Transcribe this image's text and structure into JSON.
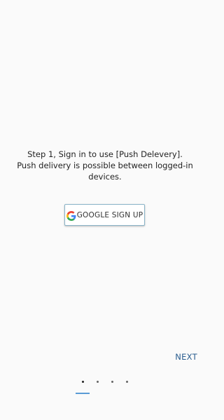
{
  "intro": {
    "step_text": "Step 1, Sign in to use [Push Delevery].\nPush delivery is possible between logged-in\ndevices."
  },
  "google_button": {
    "label": "GOOGLE SIGN UP",
    "icon": "google-g-icon"
  },
  "navigation": {
    "next_label": "NEXT"
  },
  "pager": {
    "page_count": 4,
    "current_page": 1
  },
  "colors": {
    "background": "#fafafa",
    "next_text": "#2a5d8f",
    "indicator": "#5b9bd5",
    "button_border": "#8ab4c8"
  }
}
